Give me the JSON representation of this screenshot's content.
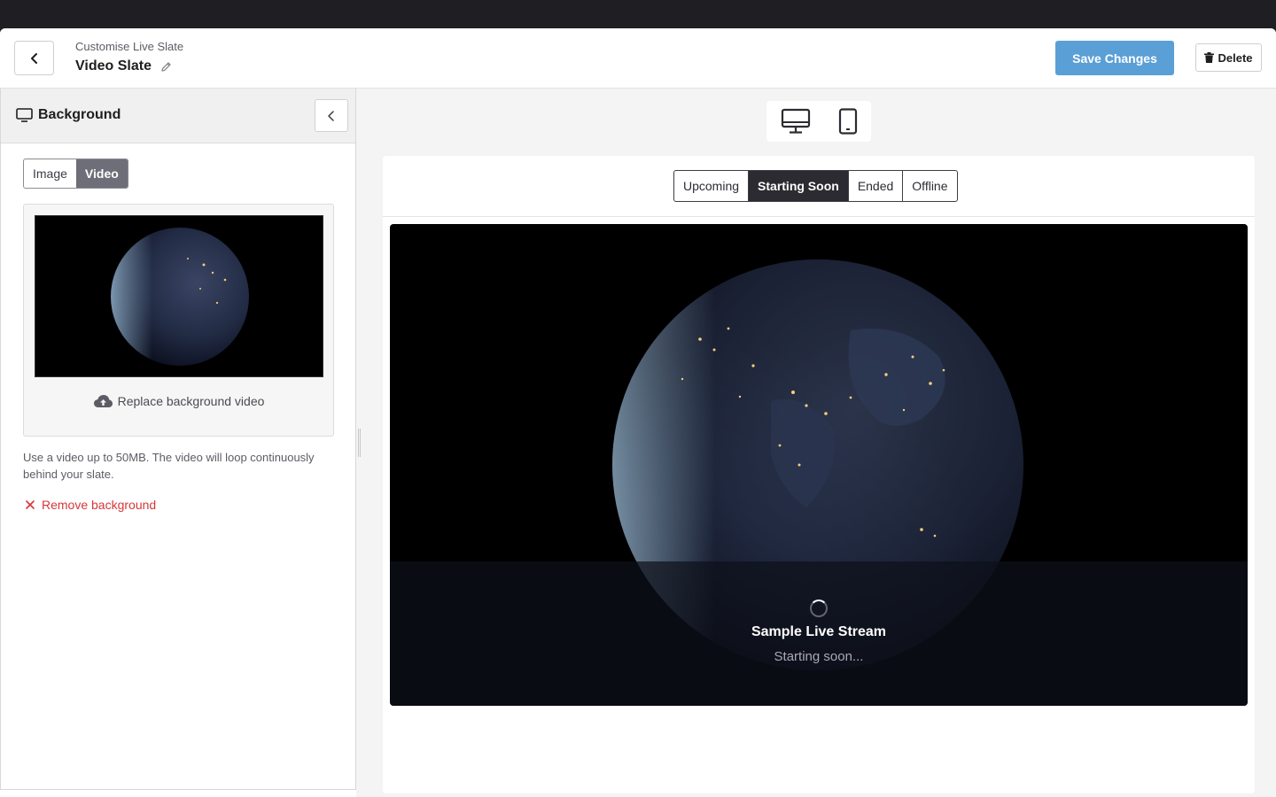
{
  "header": {
    "breadcrumb": "Customise Live Slate",
    "title": "Video Slate",
    "save_label": "Save Changes",
    "delete_label": "Delete"
  },
  "sidebar": {
    "section_title": "Background",
    "media_types": [
      "Image",
      "Video"
    ],
    "selected_media_type": "Video",
    "replace_label": "Replace background video",
    "help_text": "Use a video up to 50MB. The video will loop continuously behind your slate.",
    "remove_label": "Remove background"
  },
  "preview": {
    "devices": [
      "desktop-icon",
      "mobile-icon"
    ],
    "selected_device": "desktop",
    "states": [
      "Upcoming",
      "Starting Soon",
      "Ended",
      "Offline"
    ],
    "selected_state": "Starting Soon",
    "stream_name": "Sample Live Stream",
    "stream_status": "Starting soon..."
  },
  "colors": {
    "accent": "#5a9fd6",
    "danger": "#d63638",
    "active_tab": "#2b2b31",
    "active_segment": "#6e6e78"
  }
}
